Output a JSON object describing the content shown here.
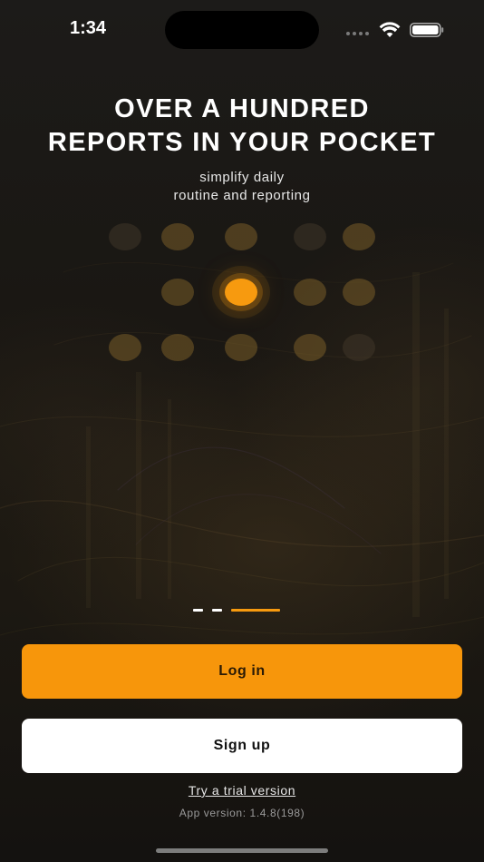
{
  "status_bar": {
    "time": "1:34",
    "icons": [
      "cellular-signal-icon",
      "wifi-icon",
      "battery-icon"
    ]
  },
  "onboarding": {
    "headline_line1": "OVER A HUNDRED",
    "headline_line2": "REPORTS IN YOUR POCKET",
    "subtitle_line1": "simplify daily",
    "subtitle_line2": "routine and reporting",
    "page_indicator": {
      "total": 3,
      "current": 3
    }
  },
  "actions": {
    "login_label": "Log in",
    "signup_label": "Sign up",
    "trial_label": "Try a trial version"
  },
  "footer": {
    "app_version": "App version: 1.4.8(198)"
  },
  "colors": {
    "accent": "#f7960b",
    "background": "#1a1713",
    "text": "#ffffff"
  }
}
